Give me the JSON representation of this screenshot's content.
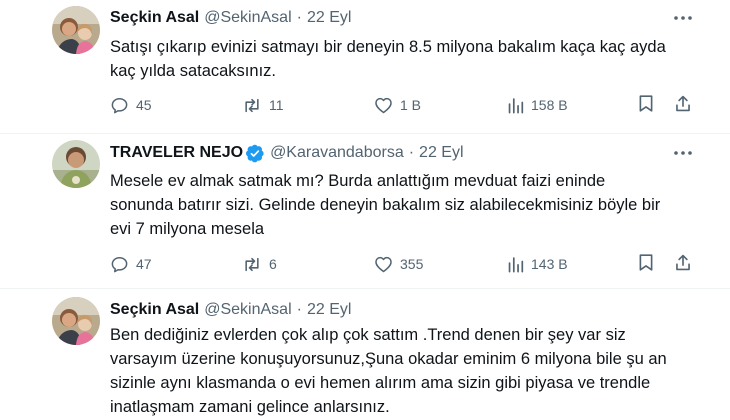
{
  "tweets": [
    {
      "name": "Seçkin Asal",
      "handle": "@SekinAsal",
      "separator": "·",
      "date": "22 Eyl",
      "text_lines": [
        "Satışı çıkarıp evinizi satmayı bir deneyin 8.5 milyona bakalım kaça kaç ayda",
        "kaç yılda satacaksınız."
      ],
      "replies": "45",
      "reposts": "11",
      "likes": "1 B",
      "views": "158 B",
      "verified": false
    },
    {
      "name": "TRAVELER NEJO",
      "handle": "@Karavandaborsa",
      "separator": "·",
      "date": "22 Eyl",
      "text_lines": [
        "Mesele ev almak satmak mı? Burda anlattığım mevduat faizi eninde",
        "sonunda batırır sizi. Gelinde deneyin bakalım siz alabilecekmisiniz böyle bir",
        "evi 7 milyona mesela"
      ],
      "replies": "47",
      "reposts": "6",
      "likes": "355",
      "views": "143 B",
      "verified": true
    },
    {
      "name": "Seçkin Asal",
      "handle": "@SekinAsal",
      "separator": "·",
      "date": "22 Eyl",
      "text_lines": [
        "Ben dediğiniz evlerden çok alıp çok sattım .Trend denen bir şey var siz",
        "varsayım üzerine konuşuyorsunuz,Şuna okadar eminim 6 milyona bile şu an",
        "sizinle aynı klasmanda o evi hemen alırım ama sizin gibi piyasa ve trendle",
        "inatlaşmam zamani gelince anlarsınız."
      ],
      "verified": false
    }
  ],
  "colors": {
    "text": "#0f1419",
    "secondary": "#536471",
    "verified": "#1d9bf0",
    "divider": "#eff3f4"
  },
  "icons": [
    "more-icon",
    "reply-icon",
    "repost-icon",
    "like-icon",
    "views-icon",
    "bookmark-icon",
    "share-icon",
    "verified-icon"
  ]
}
